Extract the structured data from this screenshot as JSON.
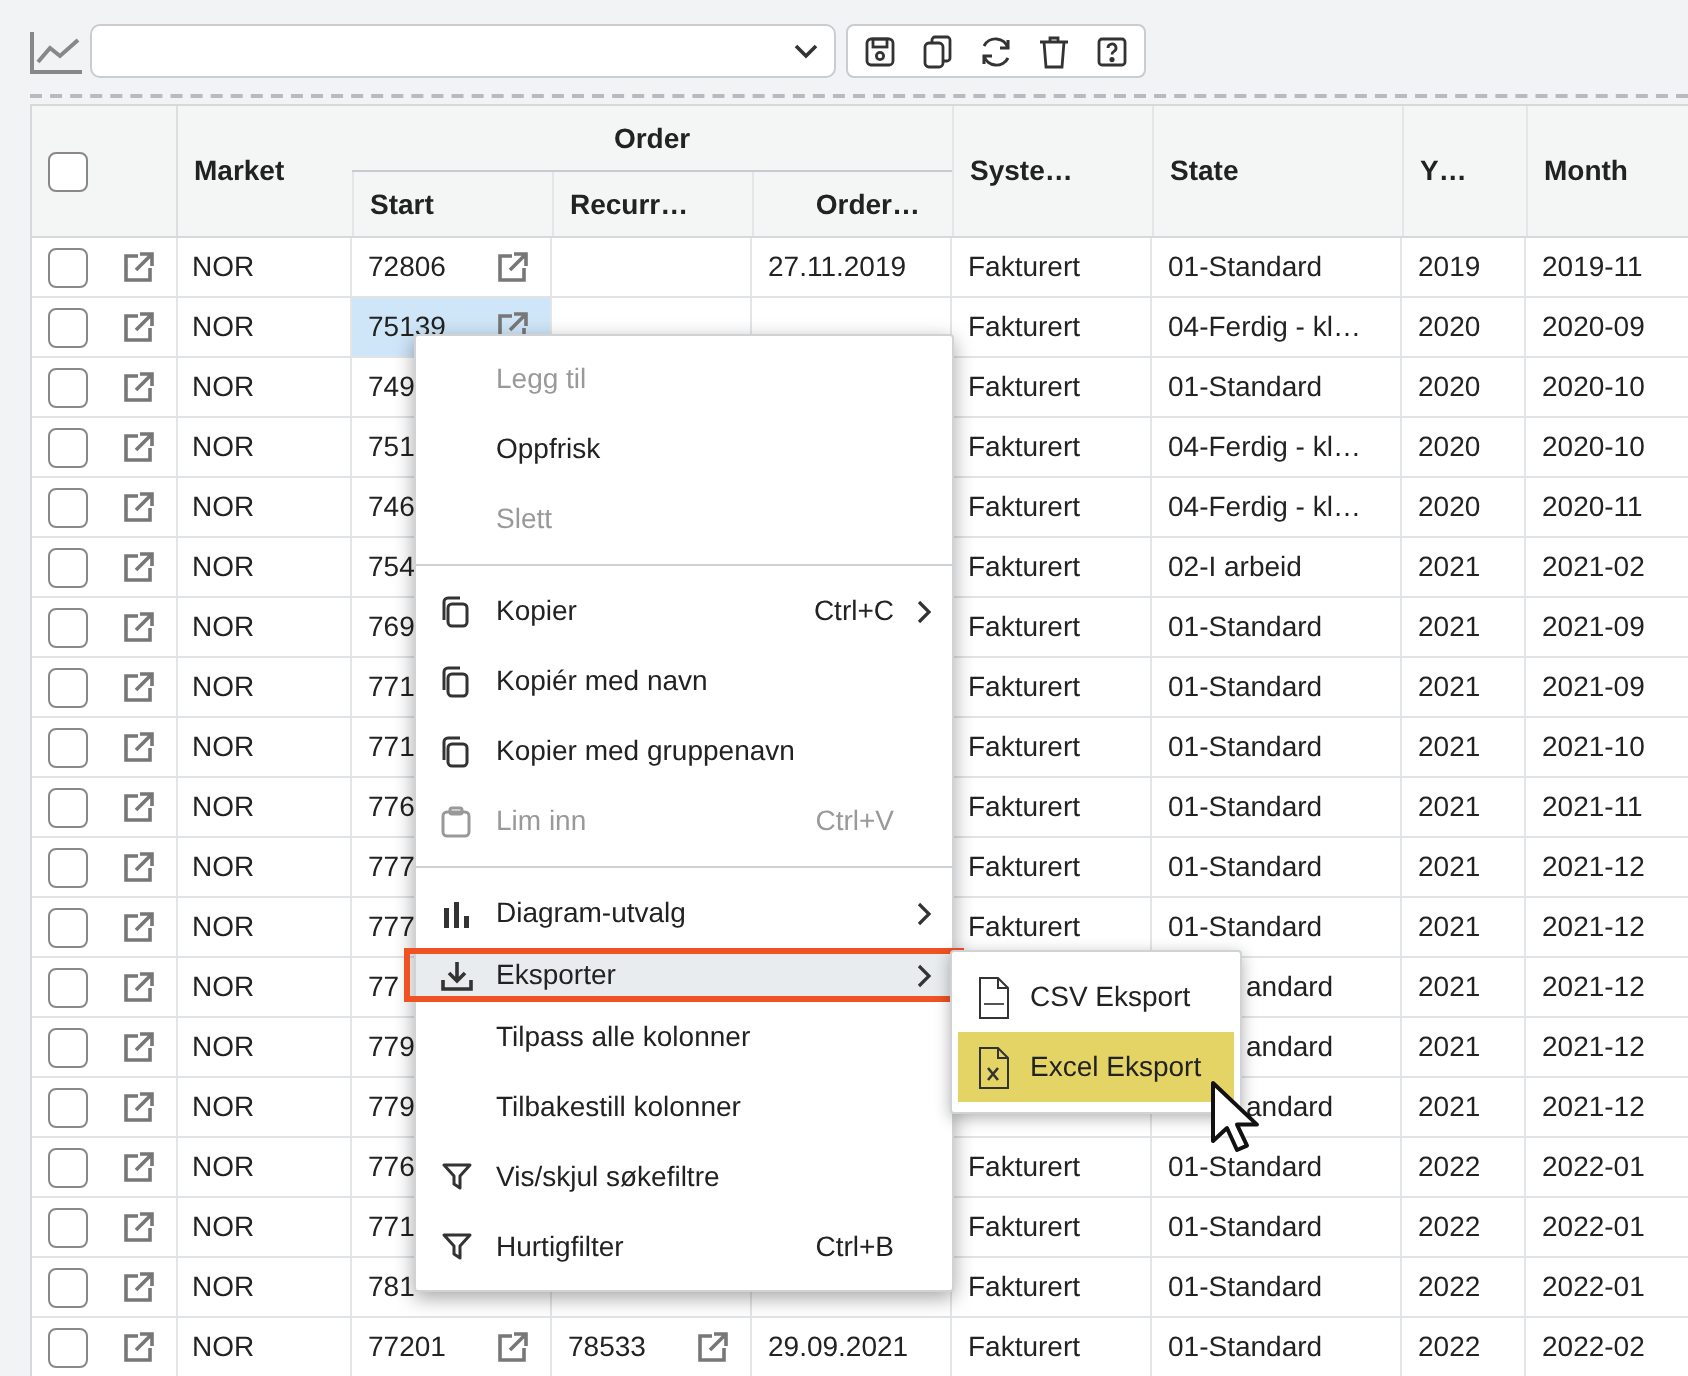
{
  "table": {
    "group_header": "Order",
    "select_all_checked": false,
    "columns": [
      "Market",
      "Start",
      "Recurr…",
      "Order…",
      "Syste…",
      "State",
      "Y…",
      "Month"
    ],
    "rows": [
      {
        "checked": false,
        "market": "NOR",
        "start": "72806",
        "start_link": true,
        "start_selected": false,
        "order_date": "27.11.2019",
        "system": "Fakturert",
        "state": "01-Standard",
        "state_partly_hidden": false,
        "year": "2019",
        "month": "2019-11"
      },
      {
        "checked": false,
        "market": "NOR",
        "start": "75139",
        "start_link": true,
        "start_selected": true,
        "system": "Fakturert",
        "state": "04-Ferdig - kl…",
        "state_partly_hidden": false,
        "year": "2020",
        "month": "2020-09"
      },
      {
        "checked": false,
        "market": "NOR",
        "start": "749",
        "start_selected": false,
        "system": "Fakturert",
        "state": "01-Standard",
        "state_partly_hidden": false,
        "year": "2020",
        "month": "2020-10"
      },
      {
        "checked": false,
        "market": "NOR",
        "start": "751",
        "start_selected": false,
        "system": "Fakturert",
        "state": "04-Ferdig - kl…",
        "state_partly_hidden": false,
        "year": "2020",
        "month": "2020-10"
      },
      {
        "checked": false,
        "market": "NOR",
        "start": "746",
        "start_selected": false,
        "system": "Fakturert",
        "state": "04-Ferdig - kl…",
        "state_partly_hidden": false,
        "year": "2020",
        "month": "2020-11"
      },
      {
        "checked": false,
        "market": "NOR",
        "start": "754",
        "start_selected": false,
        "system": "Fakturert",
        "state": "02-I arbeid",
        "state_partly_hidden": false,
        "year": "2021",
        "month": "2021-02"
      },
      {
        "checked": false,
        "market": "NOR",
        "start": "769",
        "start_selected": false,
        "system": "Fakturert",
        "state": "01-Standard",
        "state_partly_hidden": false,
        "year": "2021",
        "month": "2021-09"
      },
      {
        "checked": false,
        "market": "NOR",
        "start": "771",
        "start_selected": false,
        "system": "Fakturert",
        "state": "01-Standard",
        "state_partly_hidden": false,
        "year": "2021",
        "month": "2021-09"
      },
      {
        "checked": false,
        "market": "NOR",
        "start": "771",
        "start_selected": false,
        "system": "Fakturert",
        "state": "01-Standard",
        "state_partly_hidden": false,
        "year": "2021",
        "month": "2021-10"
      },
      {
        "checked": false,
        "market": "NOR",
        "start": "776",
        "start_selected": false,
        "system": "Fakturert",
        "state": "01-Standard",
        "state_partly_hidden": false,
        "year": "2021",
        "month": "2021-11"
      },
      {
        "checked": false,
        "market": "NOR",
        "start": "777",
        "start_selected": false,
        "system": "Fakturert",
        "state": "01-Standard",
        "state_partly_hidden": false,
        "year": "2021",
        "month": "2021-12"
      },
      {
        "checked": false,
        "market": "NOR",
        "start": "777",
        "start_selected": false,
        "system": "Fakturert",
        "state": "01-Standard",
        "state_partly_hidden": false,
        "year": "2021",
        "month": "2021-12"
      },
      {
        "checked": false,
        "market": "NOR",
        "start": "77",
        "start_selected": false,
        "state": "andard",
        "state_partly_hidden": true,
        "year": "2021",
        "month": "2021-12"
      },
      {
        "checked": false,
        "market": "NOR",
        "start": "779",
        "start_selected": false,
        "state": "andard",
        "state_partly_hidden": true,
        "year": "2021",
        "month": "2021-12"
      },
      {
        "checked": false,
        "market": "NOR",
        "start": "779",
        "start_selected": false,
        "state": "andard",
        "state_partly_hidden": true,
        "year": "2021",
        "month": "2021-12"
      },
      {
        "checked": false,
        "market": "NOR",
        "start": "776",
        "start_selected": false,
        "system": "Fakturert",
        "state": "01-Standard",
        "state_partly_hidden": false,
        "year": "2022",
        "month": "2022-01"
      },
      {
        "checked": false,
        "market": "NOR",
        "start": "771",
        "start_selected": false,
        "system": "Fakturert",
        "state": "01-Standard",
        "state_partly_hidden": false,
        "year": "2022",
        "month": "2022-01"
      },
      {
        "checked": false,
        "market": "NOR",
        "start": "781",
        "start_selected": false,
        "system": "Fakturert",
        "state": "01-Standard",
        "state_partly_hidden": false,
        "year": "2022",
        "month": "2022-01"
      },
      {
        "checked": false,
        "market": "NOR",
        "start": "77201",
        "start_link": true,
        "start_selected": false,
        "recurring": "78533",
        "order_date": "29.09.2021",
        "system": "Fakturert",
        "state": "01-Standard",
        "state_partly_hidden": false,
        "year": "2022",
        "month": "2022-02"
      }
    ]
  },
  "context_menu": {
    "items": [
      {
        "kind": "plain",
        "label": "Legg til",
        "disabled": true,
        "highlighted": false,
        "callout": false
      },
      {
        "kind": "plain",
        "label": "Oppfrisk",
        "disabled": false,
        "highlighted": false,
        "callout": false
      },
      {
        "kind": "plain",
        "label": "Slett",
        "disabled": true,
        "highlighted": false,
        "callout": false
      },
      {
        "kind": "separator"
      },
      {
        "kind": "copy",
        "label": "Kopier",
        "shortcut": "Ctrl+C",
        "submenu": true,
        "disabled": false,
        "highlighted": false,
        "callout": false
      },
      {
        "kind": "copy",
        "label": "Kopiér med navn",
        "disabled": false,
        "highlighted": false,
        "callout": false
      },
      {
        "kind": "copy",
        "label": "Kopier med gruppenavn",
        "disabled": false,
        "highlighted": false,
        "callout": false
      },
      {
        "kind": "paste",
        "label": "Lim inn",
        "shortcut": "Ctrl+V",
        "disabled": true,
        "highlighted": false,
        "callout": false
      },
      {
        "kind": "separator"
      },
      {
        "kind": "chart",
        "label": "Diagram-utvalg",
        "submenu": true,
        "disabled": false,
        "highlighted": false,
        "callout": false
      },
      {
        "kind": "export",
        "label": "Eksporter",
        "submenu": true,
        "disabled": false,
        "highlighted": true,
        "callout": true
      },
      {
        "kind": "plain",
        "label": "Tilpass alle kolonner",
        "disabled": false,
        "highlighted": false,
        "callout": false
      },
      {
        "kind": "plain",
        "label": "Tilbakestill kolonner",
        "disabled": false,
        "highlighted": false,
        "callout": false
      },
      {
        "kind": "filter",
        "label": "Vis/skjul søkefiltre",
        "disabled": false,
        "highlighted": false,
        "callout": false
      },
      {
        "kind": "filter",
        "label": "Hurtigfilter",
        "shortcut": "Ctrl+B",
        "disabled": false,
        "highlighted": false,
        "callout": false
      }
    ]
  },
  "submenu": {
    "items": [
      {
        "label": "CSV Eksport",
        "kind": "csv",
        "highlighted": false
      },
      {
        "label": "Excel Eksport",
        "kind": "spreadsheet",
        "highlighted": true
      }
    ]
  }
}
